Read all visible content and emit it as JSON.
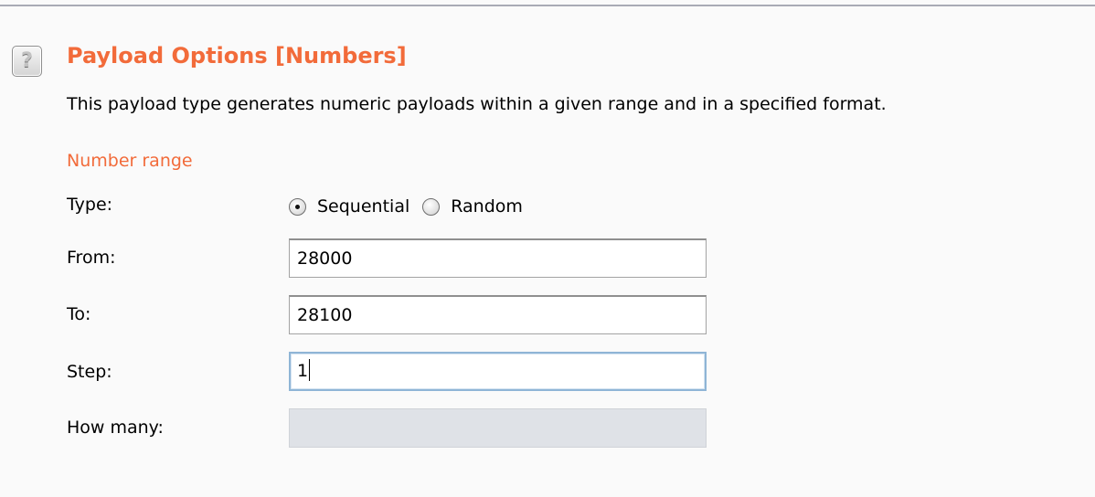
{
  "help": {
    "icon": "help-icon",
    "glyph": "?"
  },
  "panel": {
    "title": "Payload Options [Numbers]",
    "description": "This payload type generates numeric payloads within a given range and in a specified format.",
    "accent_color": "#f26b3a"
  },
  "number_range": {
    "section_title": "Number range",
    "type": {
      "label": "Type:",
      "options": [
        {
          "label": "Sequential",
          "selected": true
        },
        {
          "label": "Random",
          "selected": false
        }
      ]
    },
    "from": {
      "label": "From:",
      "value": "28000"
    },
    "to": {
      "label": "To:",
      "value": "28100"
    },
    "step": {
      "label": "Step:",
      "value": "1"
    },
    "how_many": {
      "label": "How many:",
      "value": ""
    }
  }
}
